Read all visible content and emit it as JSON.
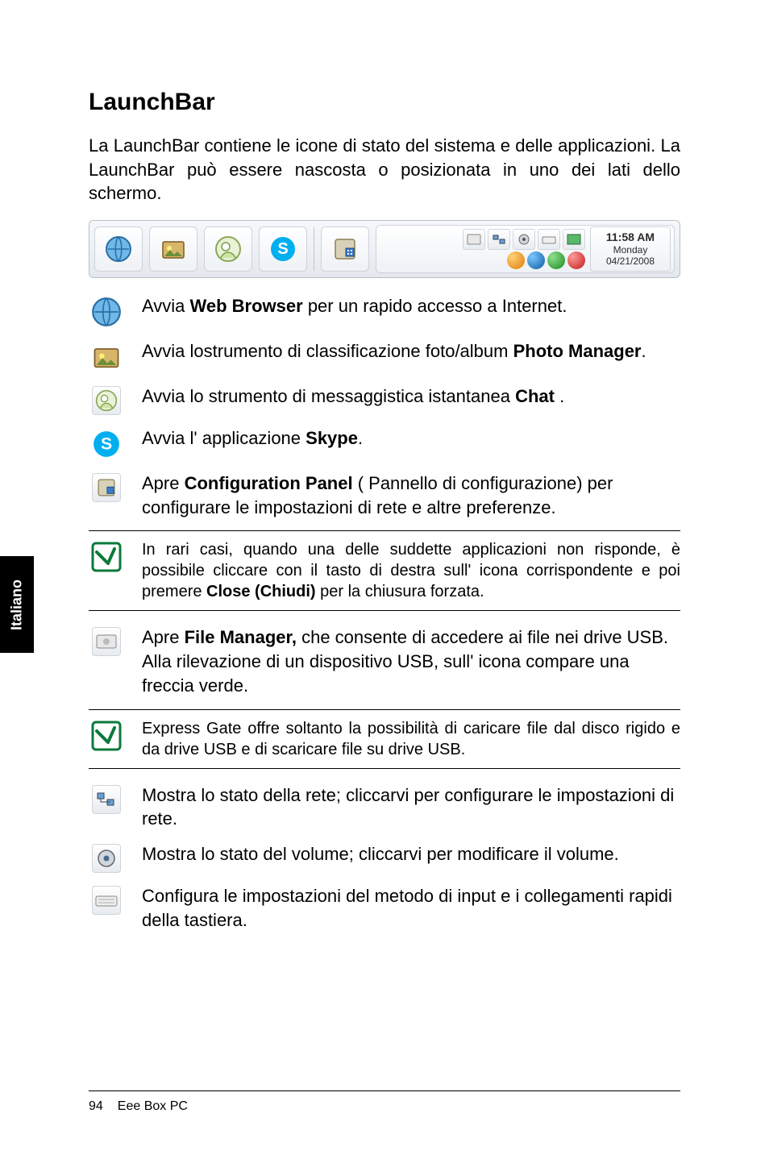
{
  "sideTab": "Italiano",
  "title": "LaunchBar",
  "intro": "La LaunchBar contiene le icone di stato del sistema e delle applicazioni. La LaunchBar può essere nascosta o posizionata in uno dei lati dello schermo.",
  "launchbar": {
    "clock": {
      "time": "11:58 AM",
      "day": "Monday",
      "date": "04/21/2008"
    }
  },
  "rows": {
    "webBrowser": {
      "pre": "Avvia ",
      "bold": "Web Browser",
      "post": " per un rapido accesso a Internet."
    },
    "photoManager": {
      "pre": "Avvia lostrumento di classificazione foto/album ",
      "bold": "Photo Manager",
      "post": "."
    },
    "chat": {
      "pre": "Avvia lo strumento di messaggistica istantanea ",
      "bold": "Chat",
      "post": " ."
    },
    "skype": {
      "pre": "Avvia l' applicazione ",
      "bold": "Skype",
      "post": "."
    },
    "configPanel": {
      "pre": "Apre ",
      "bold": "Configuration Panel",
      "post": " ( Pannello di configurazione) per configurare le impostazioni di rete e altre preferenze."
    },
    "fileManager": {
      "pre": "Apre ",
      "bold": "File Manager,",
      "post": "  che consente di accedere ai file nei drive USB. Alla rilevazione di un dispositivo USB, sull' icona compare una freccia verde."
    },
    "network": "Mostra lo stato della rete; cliccarvi per configurare le impostazioni di rete.",
    "volume": "Mostra lo stato del volume; cliccarvi per modificare il volume.",
    "keyboard": "Configura le impostazioni del metodo di input  e i collegamenti rapidi della tastiera."
  },
  "notes": {
    "close": {
      "pre": "In rari casi, quando una delle suddette applicazioni non risponde, è possibile cliccare con il tasto di destra sull' icona corrispondente e poi premere ",
      "bold": "Close (Chiudi)",
      "post": " per la chiusura forzata."
    },
    "usb": "Express Gate offre soltanto la possibilità di caricare file dal disco rigido e da drive USB e di scaricare file su drive USB."
  },
  "footer": {
    "pageNumber": "94",
    "product": "Eee Box PC"
  }
}
